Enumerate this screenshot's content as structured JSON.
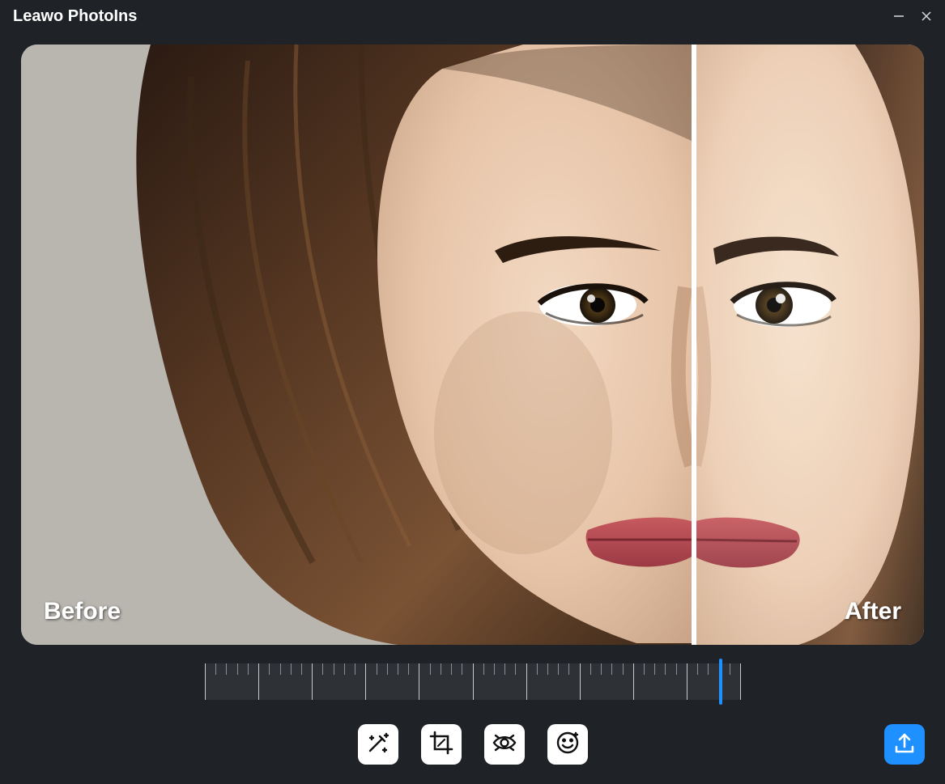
{
  "app": {
    "title": "Leawo PhotoIns"
  },
  "preview": {
    "before_label": "Before",
    "after_label": "After",
    "split_percent": 74.5
  },
  "ruler": {
    "handle_percent": 96
  },
  "tools": {
    "auto_enhance": "auto-enhance-icon",
    "crop": "crop-icon",
    "eye": "eye-enhance-icon",
    "face": "face-retouch-icon"
  },
  "export": {
    "label": "export"
  },
  "colors": {
    "accent": "#1e90ff",
    "bg": "#1f2226"
  }
}
